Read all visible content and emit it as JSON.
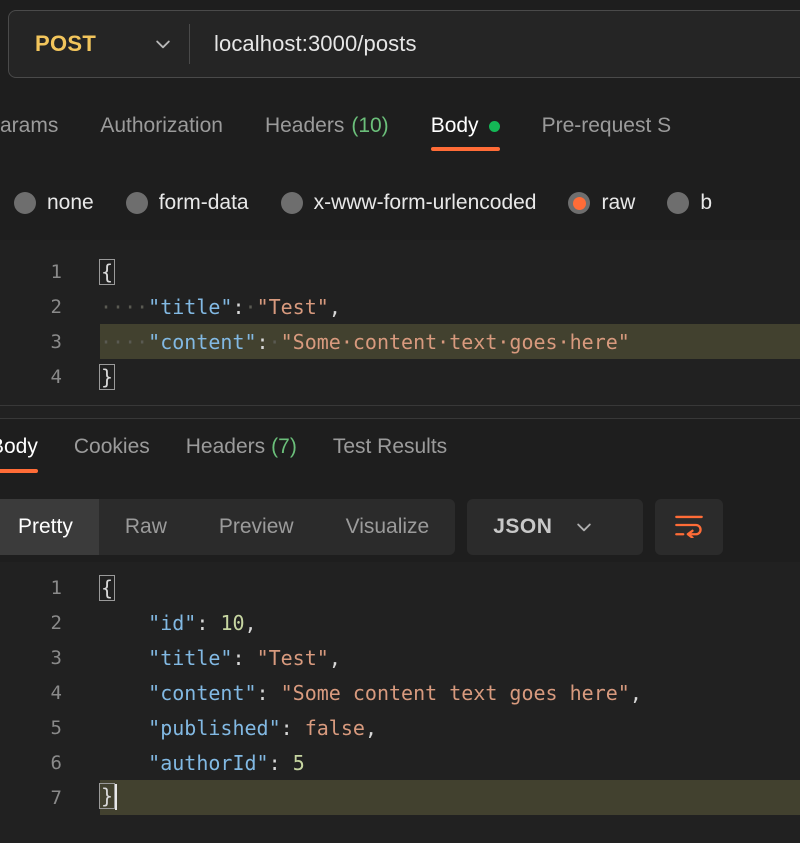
{
  "request": {
    "method": "POST",
    "method_caret_icon": "chevron-down-icon",
    "url": "localhost:3000/posts",
    "tabs": [
      {
        "label": "Params",
        "active": false,
        "count": "",
        "dot": false
      },
      {
        "label": "Authorization",
        "active": false,
        "count": "",
        "dot": false
      },
      {
        "label": "Headers",
        "active": false,
        "count": "(10)",
        "dot": false
      },
      {
        "label": "Body",
        "active": true,
        "count": "",
        "dot": true
      },
      {
        "label": "Pre-request S",
        "active": false,
        "count": "",
        "dot": false
      }
    ],
    "body_types": [
      {
        "label": "none",
        "selected": false
      },
      {
        "label": "form-data",
        "selected": false
      },
      {
        "label": "x-www-form-urlencoded",
        "selected": false
      },
      {
        "label": "raw",
        "selected": true
      },
      {
        "label": "b",
        "selected": false
      }
    ],
    "body_lines": [
      {
        "n": "1",
        "highlight": false,
        "tokens": [
          {
            "t": "brace",
            "v": "{"
          }
        ]
      },
      {
        "n": "2",
        "highlight": false,
        "tokens": [
          {
            "t": "ws",
            "v": "····"
          },
          {
            "t": "key",
            "v": "\"title\""
          },
          {
            "t": "punc",
            "v": ":"
          },
          {
            "t": "ws",
            "v": "·"
          },
          {
            "t": "str",
            "v": "\"Test\""
          },
          {
            "t": "punc",
            "v": ","
          }
        ]
      },
      {
        "n": "3",
        "highlight": true,
        "tokens": [
          {
            "t": "ws",
            "v": "····"
          },
          {
            "t": "key",
            "v": "\"content\""
          },
          {
            "t": "punc",
            "v": ":"
          },
          {
            "t": "ws",
            "v": "·"
          },
          {
            "t": "str",
            "v": "\"Some·content·text·goes·here\""
          }
        ]
      },
      {
        "n": "4",
        "highlight": false,
        "tokens": [
          {
            "t": "brace",
            "v": "}"
          }
        ]
      }
    ]
  },
  "response": {
    "tabs": [
      {
        "label": "Body",
        "active": true,
        "count": ""
      },
      {
        "label": "Cookies",
        "active": false,
        "count": ""
      },
      {
        "label": "Headers",
        "active": false,
        "count": "(7)"
      },
      {
        "label": "Test Results",
        "active": false,
        "count": ""
      }
    ],
    "view_modes": [
      {
        "label": "Pretty",
        "active": true
      },
      {
        "label": "Raw",
        "active": false
      },
      {
        "label": "Preview",
        "active": false
      },
      {
        "label": "Visualize",
        "active": false
      }
    ],
    "format": "JSON",
    "format_caret_icon": "chevron-down-icon",
    "wrap_icon": "word-wrap-icon",
    "body_lines": [
      {
        "n": "1",
        "highlight": false,
        "caret": false,
        "tokens": [
          {
            "t": "brace",
            "v": "{"
          }
        ]
      },
      {
        "n": "2",
        "highlight": false,
        "caret": false,
        "tokens": [
          {
            "t": "plain",
            "v": "    "
          },
          {
            "t": "key",
            "v": "\"id\""
          },
          {
            "t": "punc",
            "v": ":"
          },
          {
            "t": "plain",
            "v": " "
          },
          {
            "t": "num",
            "v": "10"
          },
          {
            "t": "punc",
            "v": ","
          }
        ]
      },
      {
        "n": "3",
        "highlight": false,
        "caret": false,
        "tokens": [
          {
            "t": "plain",
            "v": "    "
          },
          {
            "t": "key",
            "v": "\"title\""
          },
          {
            "t": "punc",
            "v": ":"
          },
          {
            "t": "plain",
            "v": " "
          },
          {
            "t": "str",
            "v": "\"Test\""
          },
          {
            "t": "punc",
            "v": ","
          }
        ]
      },
      {
        "n": "4",
        "highlight": false,
        "caret": false,
        "tokens": [
          {
            "t": "plain",
            "v": "    "
          },
          {
            "t": "key",
            "v": "\"content\""
          },
          {
            "t": "punc",
            "v": ":"
          },
          {
            "t": "plain",
            "v": " "
          },
          {
            "t": "str",
            "v": "\"Some content text goes here\""
          },
          {
            "t": "punc",
            "v": ","
          }
        ]
      },
      {
        "n": "5",
        "highlight": false,
        "caret": false,
        "tokens": [
          {
            "t": "plain",
            "v": "    "
          },
          {
            "t": "key",
            "v": "\"published\""
          },
          {
            "t": "punc",
            "v": ":"
          },
          {
            "t": "plain",
            "v": " "
          },
          {
            "t": "bool",
            "v": "false"
          },
          {
            "t": "punc",
            "v": ","
          }
        ]
      },
      {
        "n": "6",
        "highlight": false,
        "caret": false,
        "tokens": [
          {
            "t": "plain",
            "v": "    "
          },
          {
            "t": "key",
            "v": "\"authorId\""
          },
          {
            "t": "punc",
            "v": ":"
          },
          {
            "t": "plain",
            "v": " "
          },
          {
            "t": "num",
            "v": "5"
          }
        ]
      },
      {
        "n": "7",
        "highlight": true,
        "caret": true,
        "tokens": [
          {
            "t": "brace",
            "v": "}"
          }
        ]
      }
    ]
  },
  "colors": {
    "accent": "#ff6c37",
    "method": "#f2c55c",
    "green": "#6bbf7a",
    "dot_green": "#14b856",
    "key": "#82b9e3",
    "string": "#d89a7e",
    "number": "#c7d6a1",
    "highlight_line": "#42412f",
    "editor_bg": "#212121",
    "app_bg": "#1e1e1e"
  }
}
